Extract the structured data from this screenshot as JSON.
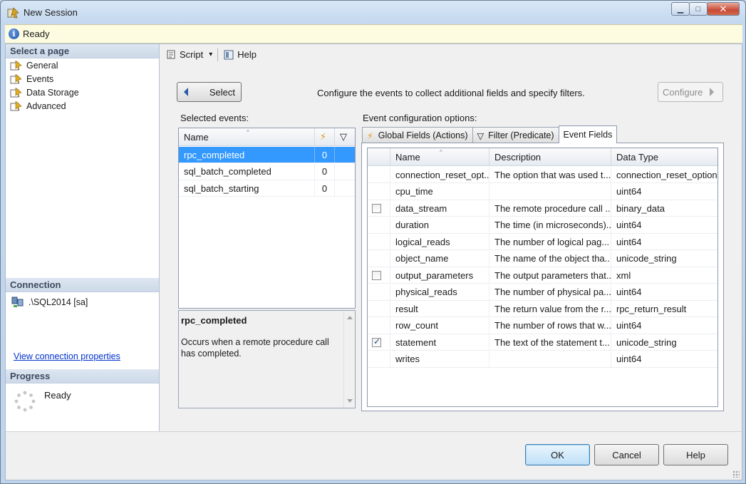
{
  "window": {
    "title": "New Session",
    "minimize": "▁",
    "maximize": "□",
    "close": "✕"
  },
  "status": {
    "text": "Ready",
    "icon": "i"
  },
  "left": {
    "select_page_header": "Select a page",
    "pages": [
      "General",
      "Events",
      "Data Storage",
      "Advanced"
    ],
    "connection_header": "Connection",
    "connection_server": ".\\SQL2014 [sa]",
    "view_connection_link": "View connection properties",
    "progress_header": "Progress",
    "progress_status": "Ready"
  },
  "toolbar": {
    "script_label": "Script",
    "script_dropdown": "▾",
    "help_label": "Help"
  },
  "events": {
    "select_button": "Select",
    "instructions": "Configure the events to collect additional fields and specify filters.",
    "configure_button": "Configure",
    "selected_label": "Selected events:",
    "columns": {
      "name": "Name",
      "actions_icon": "⚡",
      "filter_icon": "▽"
    },
    "rows": [
      {
        "name": "rpc_completed",
        "count": "0"
      },
      {
        "name": "sql_batch_completed",
        "count": "0"
      },
      {
        "name": "sql_batch_starting",
        "count": "0"
      }
    ],
    "selected_index": 0,
    "description_title": "rpc_completed",
    "description_body": "Occurs when a remote procedure call has completed."
  },
  "config": {
    "label": "Event configuration options:",
    "tabs": [
      "Global Fields (Actions)",
      "Filter (Predicate)",
      "Event Fields"
    ],
    "active_tab": 2,
    "columns": [
      "Name",
      "Description",
      "Data Type"
    ],
    "fields": [
      {
        "checkbox": "none",
        "name": "connection_reset_opt...",
        "description": "The option that was used t...",
        "type": "connection_reset_option"
      },
      {
        "checkbox": "none",
        "name": "cpu_time",
        "description": "",
        "type": "uint64"
      },
      {
        "checkbox": "off",
        "name": "data_stream",
        "description": "The remote procedure call ...",
        "type": "binary_data"
      },
      {
        "checkbox": "none",
        "name": "duration",
        "description": "The time (in microseconds)...",
        "type": "uint64"
      },
      {
        "checkbox": "none",
        "name": "logical_reads",
        "description": "The number of logical pag...",
        "type": "uint64"
      },
      {
        "checkbox": "none",
        "name": "object_name",
        "description": "The name of the object tha...",
        "type": "unicode_string"
      },
      {
        "checkbox": "off",
        "name": "output_parameters",
        "description": "The output parameters that...",
        "type": "xml"
      },
      {
        "checkbox": "none",
        "name": "physical_reads",
        "description": "The number of physical pa...",
        "type": "uint64"
      },
      {
        "checkbox": "none",
        "name": "result",
        "description": "The return value from the r...",
        "type": "rpc_return_result"
      },
      {
        "checkbox": "none",
        "name": "row_count",
        "description": "The number of rows that w...",
        "type": "uint64"
      },
      {
        "checkbox": "on",
        "name": "statement",
        "description": "The text of the statement t...",
        "type": "unicode_string"
      },
      {
        "checkbox": "none",
        "name": "writes",
        "description": "",
        "type": "uint64"
      }
    ]
  },
  "buttons": {
    "ok": "OK",
    "cancel": "Cancel",
    "help": "Help"
  },
  "colors": {
    "selection": "#3399ff",
    "status_bg": "#fdfbe0",
    "link": "#0033cc"
  }
}
